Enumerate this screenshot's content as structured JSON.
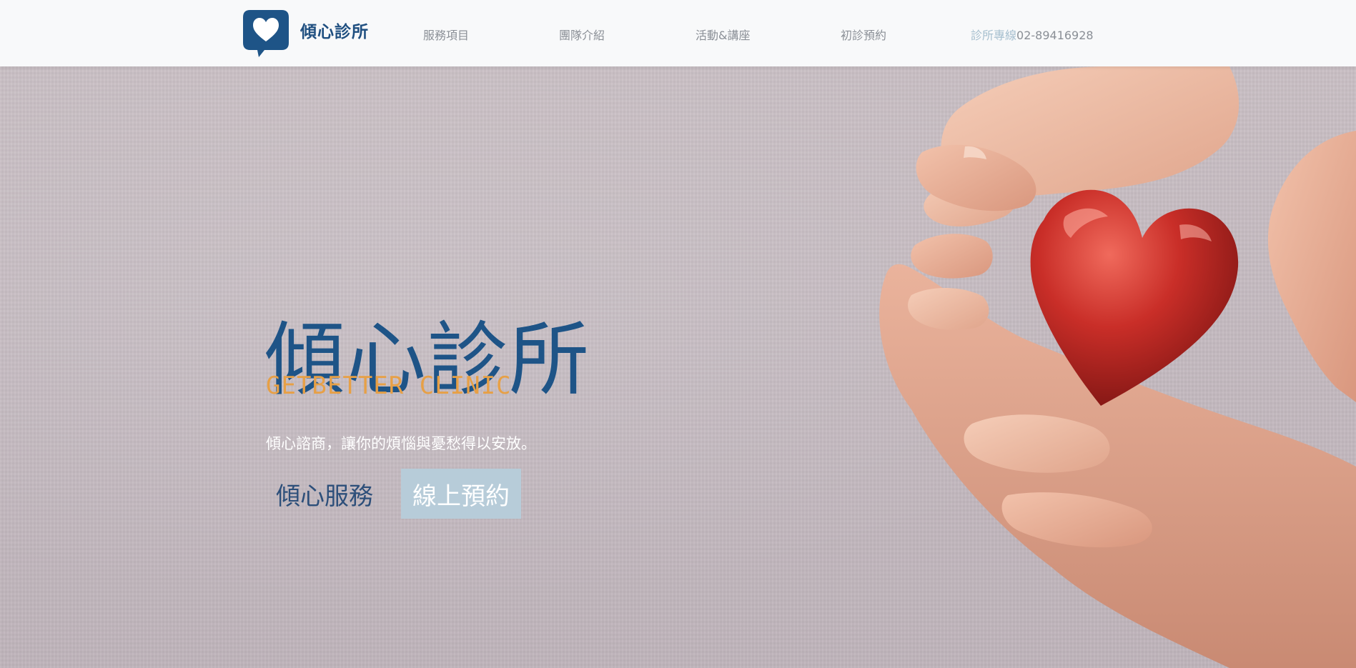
{
  "header": {
    "brand": "傾心診所",
    "nav": [
      {
        "label": "服務項目"
      },
      {
        "label": "團隊介紹"
      },
      {
        "label": "活動&講座"
      },
      {
        "label": "初診預約"
      }
    ],
    "phone_label": "診所專線",
    "phone_number": "02-89416928"
  },
  "hero": {
    "title": "傾心診所",
    "subtitle": "GETBETTER CLINIC",
    "tagline": "傾心諮商，讓你的煩惱與憂愁得以安放。",
    "buttons": {
      "services": "傾心服務",
      "booking": "線上預約"
    }
  },
  "icons": {
    "logo": "heart-chat-bubble-icon",
    "hero_image": "hands-holding-heart"
  },
  "colors": {
    "brand_blue": "#1e5487",
    "accent_orange": "#e7a046",
    "booking_button": "#b7ccd9",
    "header_bg": "#f8f9fa",
    "hero_bg": "#c6bcc2"
  }
}
